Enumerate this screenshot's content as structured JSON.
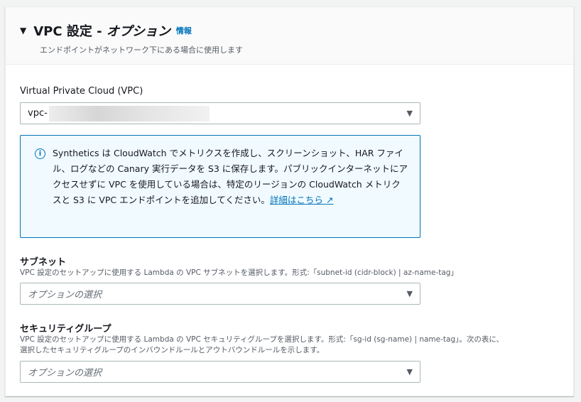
{
  "header": {
    "title_prefix": "VPC 設定 - ",
    "title_italic": "オプション",
    "info": "情報",
    "subtitle": "エンドポイントがネットワーク下にある場合に使用します"
  },
  "vpc": {
    "label": "Virtual Private Cloud (VPC)",
    "value": "vpc-"
  },
  "alert": {
    "text": "Synthetics は CloudWatch でメトリクスを作成し、スクリーンショット、HAR ファイル、ログなどの Canary 実行データを S3 に保存します。パブリックインターネットにアクセスせずに VPC を使用している場合は、特定のリージョンの CloudWatch メトリクスと S3 に VPC エンドポイントを追加してください。",
    "link": "詳細はこちら"
  },
  "subnet": {
    "label": "サブネット",
    "desc": "VPC 設定のセットアップに使用する Lambda の VPC サブネットを選択します。形式:「subnet-id (cidr-block) | az-name-tag」",
    "placeholder": "オプションの選択"
  },
  "sg": {
    "label": "セキュリティグループ",
    "desc1": "VPC 設定のセットアップに使用する Lambda の VPC セキュリティグループを選択します。形式:「sg-id (sg-name) | name-tag」。次の表に、",
    "desc2": "選択したセキュリティグループのインバウンドルールとアウトバウンドルールを示します。",
    "placeholder": "オプションの選択"
  }
}
